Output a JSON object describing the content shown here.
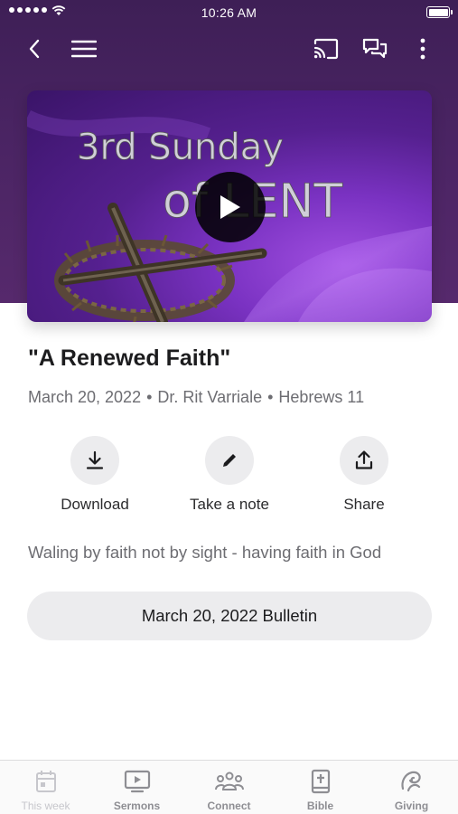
{
  "status_bar": {
    "time": "10:26 AM"
  },
  "video": {
    "thumbnail_text_line1": "3rd Sunday",
    "thumbnail_text_line2": "of LENT"
  },
  "sermon": {
    "title": "\"A Renewed Faith\"",
    "date": "March 20, 2022",
    "speaker": "Dr. Rit Varriale",
    "scripture": "Hebrews 11",
    "separator": "•",
    "description": "Waling by faith not by sight - having faith in God"
  },
  "actions": {
    "download_label": "Download",
    "note_label": "Take a note",
    "share_label": "Share"
  },
  "bulletin_button": "March 20, 2022 Bulletin",
  "tabs": [
    {
      "label": "This week",
      "icon": "calendar-icon",
      "active": true
    },
    {
      "label": "Sermons",
      "icon": "tv-play-icon",
      "active": false
    },
    {
      "label": "Connect",
      "icon": "people-icon",
      "active": false
    },
    {
      "label": "Bible",
      "icon": "bible-icon",
      "active": false
    },
    {
      "label": "Giving",
      "icon": "giving-icon",
      "active": false
    }
  ],
  "colors": {
    "header_purple": "#4a2463",
    "button_gray": "#ececee",
    "text_secondary": "#6d6d72"
  }
}
